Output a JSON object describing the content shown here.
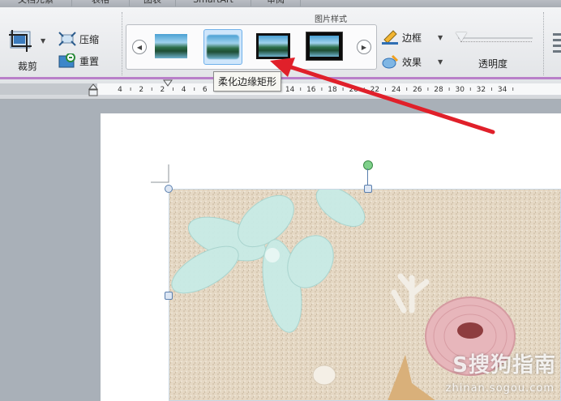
{
  "tabs": [
    "文档元素",
    "表格",
    "图表",
    "SmartArt",
    "审阅"
  ],
  "ribbon": {
    "crop_label": "裁剪",
    "compress_label": "压缩",
    "reset_label": "重置",
    "group_title": "图片样式",
    "border_label": "边框",
    "effects_label": "效果",
    "transparency_label": "透明度"
  },
  "gallery": {
    "styles": [
      "style-plain",
      "style-soft-edge",
      "style-frame-thin",
      "style-frame-thick"
    ],
    "selected_index": 1
  },
  "tooltip": "柔化边缘矩形",
  "ruler": {
    "labels": [
      "4",
      "2",
      "2",
      "4",
      "6",
      "8",
      "10",
      "12",
      "14",
      "16",
      "18",
      "20",
      "22",
      "24",
      "26",
      "28",
      "30",
      "32",
      "34"
    ]
  },
  "watermark": {
    "brand": "S搜狗指南",
    "url": "zhinan.sogou.com"
  },
  "colors": {
    "accent_purple": "#b97fc9",
    "arrow_red": "#e0202a",
    "selection_blue": "#cfe6fb"
  }
}
